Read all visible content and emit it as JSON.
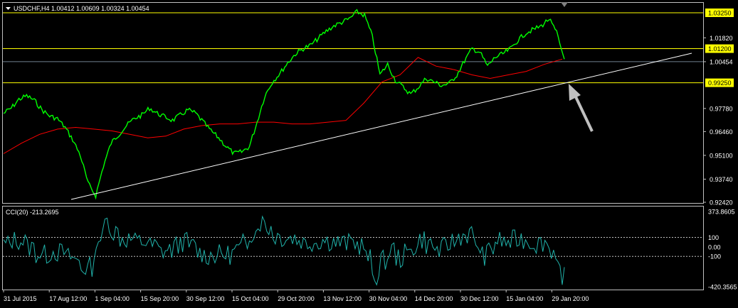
{
  "symbol": "USDCHF,H4",
  "ohlc": {
    "open": "1.00412",
    "high": "1.00609",
    "low": "1.00324",
    "close": "1.00454"
  },
  "price_axis": [
    "1.03250",
    "1.01820",
    "1.01200",
    "1.00454",
    "0.99250",
    "0.97780",
    "0.96460",
    "0.95100",
    "0.93740",
    "0.92420"
  ],
  "highlighted_levels": [
    "1.03250",
    "1.01200",
    "0.99250"
  ],
  "current_price": "1.00454",
  "cci": {
    "label": "CCI(20) -213.2695",
    "axis": [
      "373.8605",
      "100",
      "0.00",
      "-100",
      "-420.3565"
    ]
  },
  "time_axis": [
    "31 Jul 2015",
    "17 Aug 12:00",
    "1 Sep 04:00",
    "15 Sep 20:00",
    "30 Sep 12:00",
    "15 Oct 04:00",
    "29 Oct 20:00",
    "13 Nov 12:00",
    "30 Nov 04:00",
    "14 Dec 20:00",
    "30 Dec 12:00",
    "15 Jan 04:00",
    "29 Jan 20:00"
  ],
  "colors": {
    "price": "#00ff00",
    "ma": "#ff0000",
    "cci": "#20b2aa",
    "level": "#ffff00",
    "trendline": "#ffffff",
    "arrow": "#c0c0c0",
    "current": "#708090"
  },
  "chart_data": {
    "type": "line",
    "title": "USDCHF,H4",
    "x": [
      "31 Jul 2015",
      "17 Aug 12:00",
      "1 Sep 04:00",
      "15 Sep 20:00",
      "30 Sep 12:00",
      "15 Oct 04:00",
      "29 Oct 20:00",
      "13 Nov 12:00",
      "30 Nov 04:00",
      "14 Dec 20:00",
      "30 Dec 12:00",
      "15 Jan 04:00",
      "29 Jan 20:00"
    ],
    "ylim": [
      0.924,
      1.037
    ],
    "series": [
      {
        "values": [
          0.975,
          0.978,
          0.983,
          0.985,
          0.9825,
          0.977,
          0.9735,
          0.972,
          0.967,
          0.96,
          0.951,
          0.935,
          0.928,
          0.945,
          0.958,
          0.963,
          0.968,
          0.972,
          0.974,
          0.978,
          0.975,
          0.973,
          0.971,
          0.974,
          0.977,
          0.975,
          0.97,
          0.965,
          0.961,
          0.956,
          0.952,
          0.953,
          0.956,
          0.97,
          0.985,
          0.993,
          0.998,
          1.004,
          1.009,
          1.012,
          1.014,
          1.018,
          1.022,
          1.025,
          1.027,
          1.029,
          1.033,
          1.031,
          1.019,
          0.997,
          1.003,
          0.994,
          0.99,
          0.986,
          0.99,
          0.995,
          0.993,
          0.991,
          0.992,
          0.997,
          1.005,
          1.012,
          1.01,
          1.002,
          1.007,
          1.009,
          1.012,
          1.017,
          1.021,
          1.023,
          1.025,
          1.029,
          1.021,
          1.006
        ]
      },
      {
        "values": [
          0.952,
          0.958,
          0.963,
          0.966,
          0.967,
          0.966,
          0.965,
          0.963,
          0.961,
          0.962,
          0.966,
          0.968,
          0.969,
          0.969,
          0.97,
          0.97,
          0.969,
          0.969,
          0.97,
          0.971,
          0.981,
          0.993,
          0.997,
          1.007,
          1.002,
          1.0,
          0.997,
          0.995,
          0.997,
          0.999,
          1.003,
          1.006
        ]
      }
    ]
  }
}
